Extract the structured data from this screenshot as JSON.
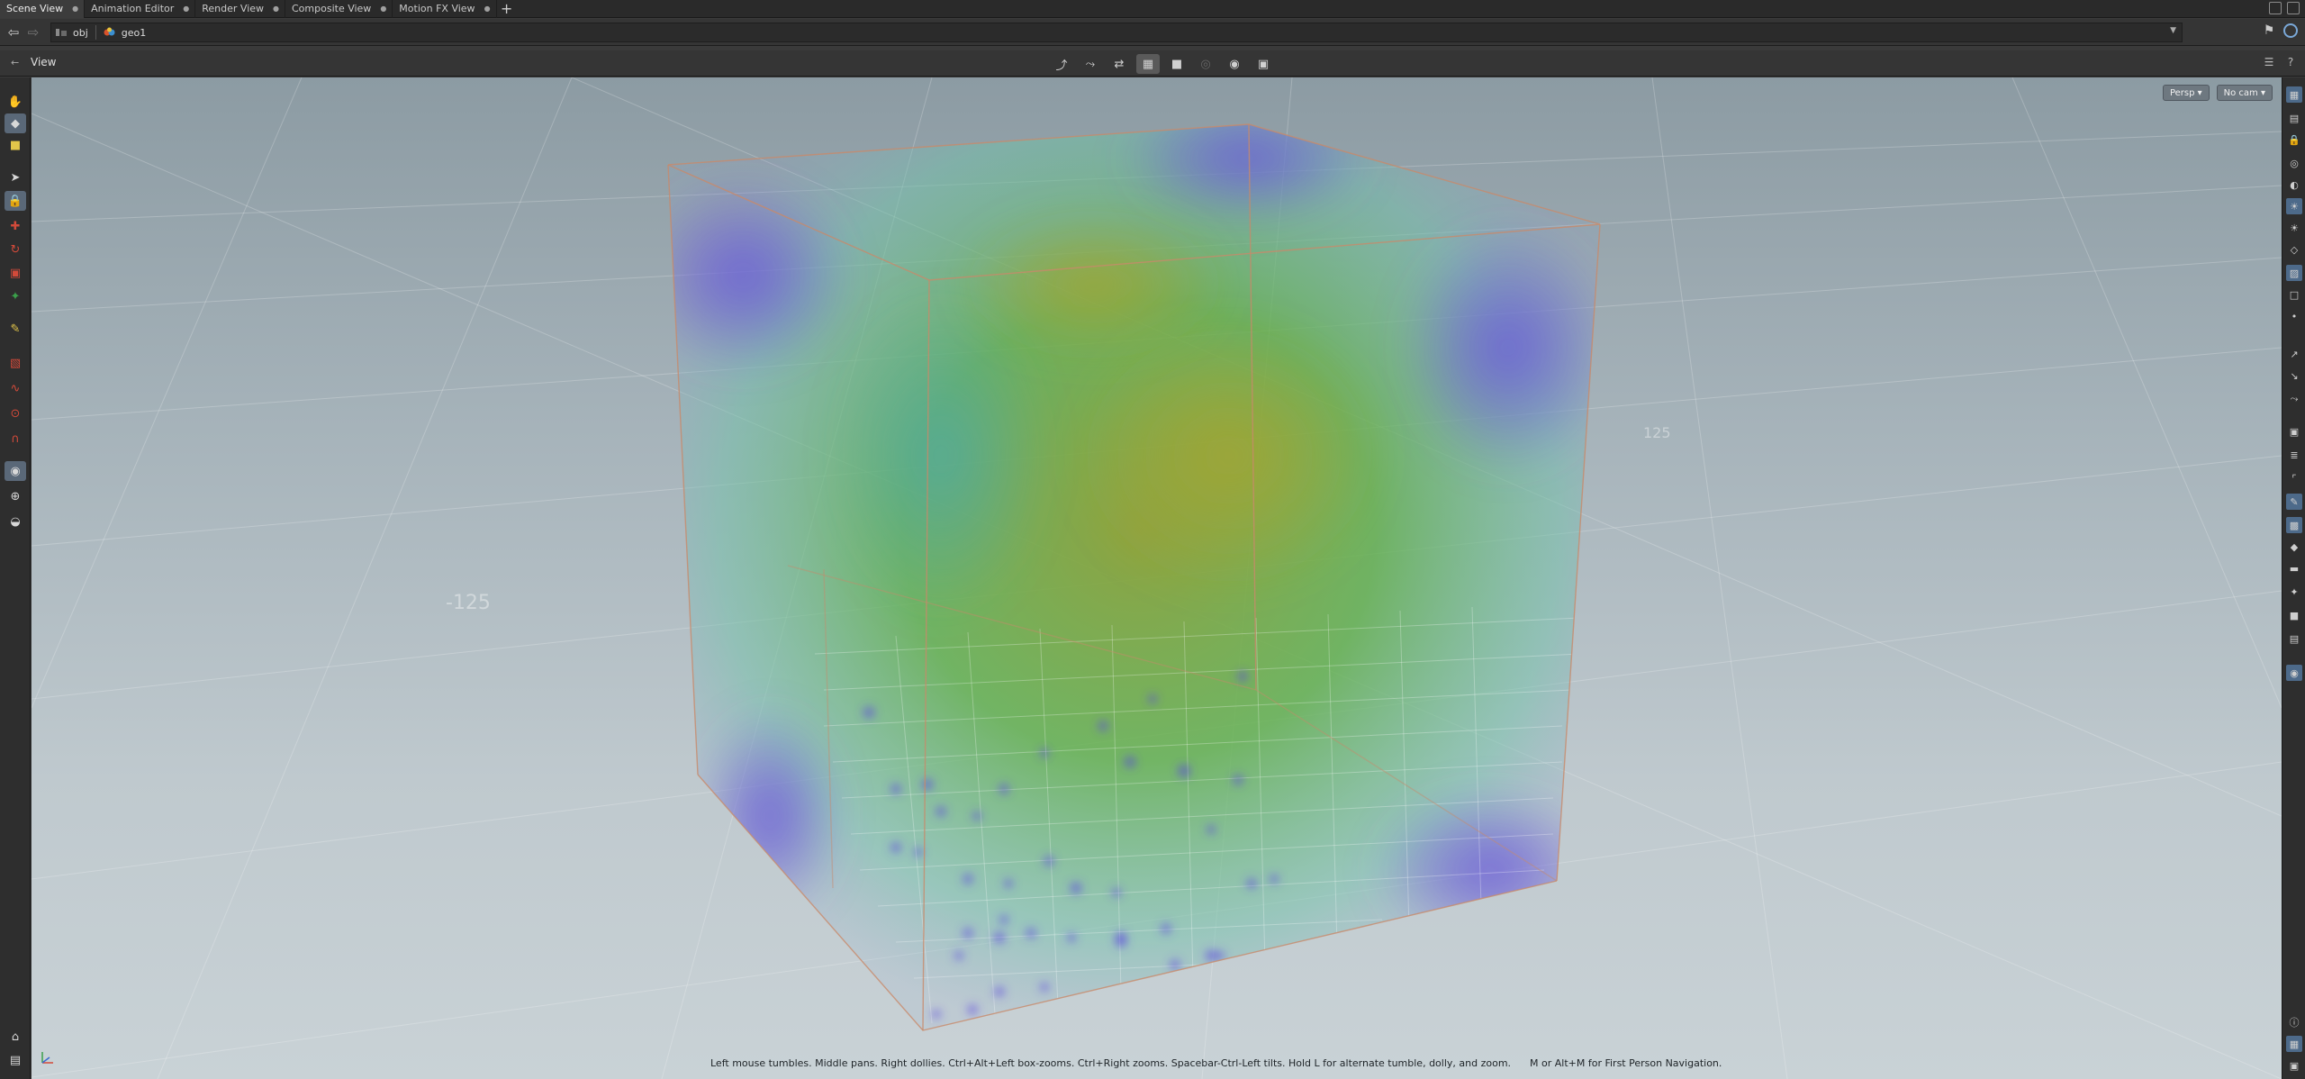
{
  "tabs": [
    {
      "label": "Scene View",
      "active": true
    },
    {
      "label": "Animation Editor",
      "active": false
    },
    {
      "label": "Render View",
      "active": false
    },
    {
      "label": "Composite View",
      "active": false
    },
    {
      "label": "Motion FX View",
      "active": false
    }
  ],
  "tab_add_label": "+",
  "path": {
    "items": [
      {
        "label": "obj",
        "icon": "obj-network-icon"
      },
      {
        "label": "geo1",
        "icon": "geo-node-icon"
      }
    ]
  },
  "viewer": {
    "title": "View",
    "camera_view": "Persp",
    "camera": "No cam",
    "hint": "Left mouse tumbles. Middle pans. Right dollies. Ctrl+Alt+Left box-zooms. Ctrl+Right zooms. Spacebar-Ctrl-Left tilts. Hold L for alternate tumble, dolly, and zoom.      M or Alt+M for First Person Navigation."
  },
  "grid_labels": [
    "-125",
    "125",
    "-125",
    "-125"
  ],
  "colors": {
    "accent": "#5a6878",
    "selected_right": "#4d6a8a",
    "volume_green": "#6fb23a",
    "volume_purple": "#7a6ad6"
  }
}
